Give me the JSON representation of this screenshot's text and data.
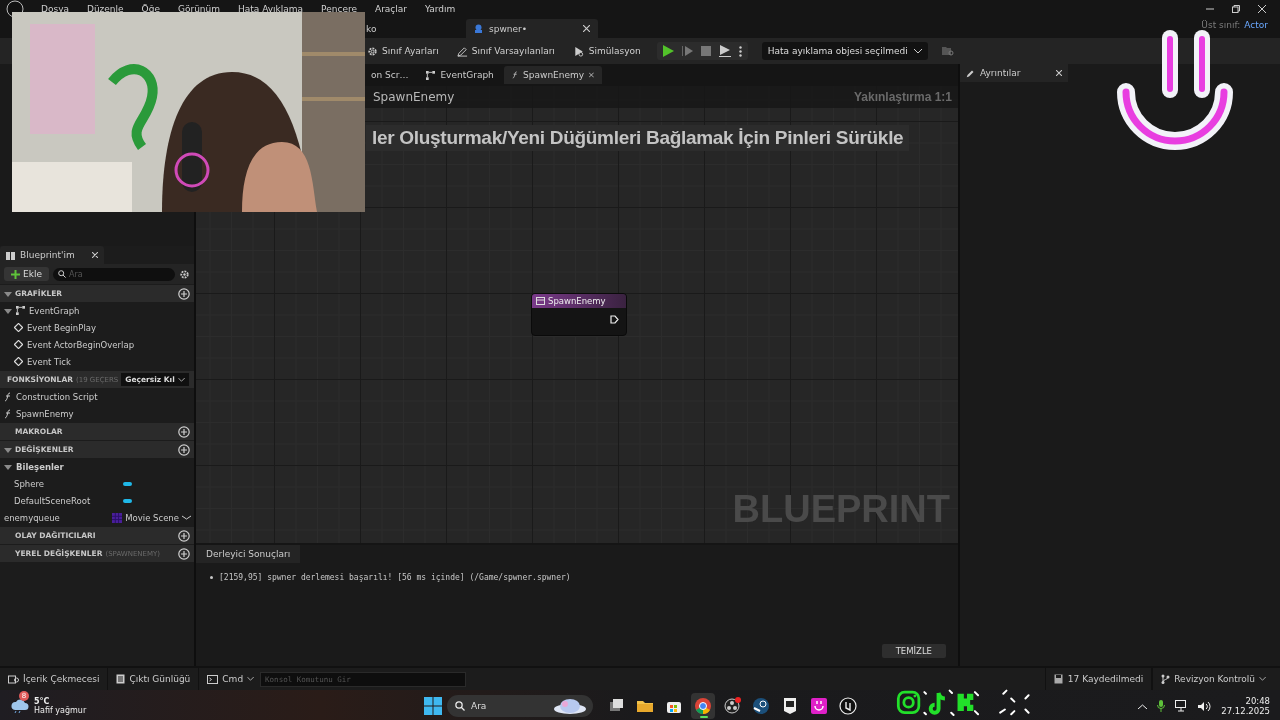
{
  "menu": [
    "Dosya",
    "Düzenle",
    "Öğe",
    "Görünüm",
    "Hata Ayıklama",
    "Pencere",
    "Araçlar",
    "Yardım"
  ],
  "parent_class": {
    "label": "Üst sınıf:",
    "value": "Actor"
  },
  "doc_tabs": [
    {
      "label": "ko",
      "selected": false
    },
    {
      "label": "spwner•",
      "selected": true
    }
  ],
  "toolbar": {
    "buttons": [
      {
        "label": "Sınıf Ayarları",
        "kind": "settings"
      },
      {
        "label": "Sınıf Varsayılanları",
        "kind": "defaults"
      },
      {
        "label": "Simülasyon",
        "kind": "simulate"
      }
    ],
    "debug_dropdown": "Hata ayıklama objesi seçilmedi"
  },
  "graph": {
    "tabs": [
      {
        "label": "on Scr…",
        "selected": false
      },
      {
        "label": "EventGraph",
        "kind": "graph",
        "selected": false
      },
      {
        "label": "SpawnEnemy",
        "kind": "function",
        "selected": true
      }
    ],
    "breadcrumb": "SpawnEnemy",
    "zoom": "Yakınlaştırma 1:1",
    "hint": "ler Oluşturmak/Yeni Düğümleri Bağlamak İçin Pinleri Sürükle",
    "node": {
      "title": "SpawnEnemy"
    },
    "watermark": "BLUEPRINT"
  },
  "my_blueprint": {
    "tab": "Blueprint'im",
    "add": "Ekle",
    "search_placeholder": "Ara",
    "sections": [
      {
        "title": "GRAFİKLER",
        "expanded": true,
        "items": [
          {
            "label": "EventGraph",
            "kind": "graph",
            "children": [
              {
                "label": "Event BeginPlay",
                "kind": "event"
              },
              {
                "label": "Event ActorBeginOverlap",
                "kind": "event"
              },
              {
                "label": "Event Tick",
                "kind": "event"
              }
            ]
          }
        ]
      },
      {
        "title": "FONKSİYONLAR",
        "note": "(19 GEÇERS",
        "dropdown": "Geçersiz Kıl",
        "expanded": true,
        "items": [
          {
            "label": "Construction Script",
            "kind": "function"
          },
          {
            "label": "SpawnEnemy",
            "kind": "function"
          }
        ]
      },
      {
        "title": "MAKROLAR",
        "expanded": false
      },
      {
        "title": "DEĞİŞKENLER",
        "expanded": true,
        "items": [
          {
            "label": "Bileşenler",
            "kind": "category",
            "children": [
              {
                "label": "Sphere",
                "kind": "component"
              },
              {
                "label": "DefaultSceneRoot",
                "kind": "component"
              }
            ]
          },
          {
            "label": "enemyqueue",
            "kind": "variable",
            "type": "Movie Scene"
          }
        ]
      },
      {
        "title": "OLAY DAĞITICILARI",
        "expanded": false
      },
      {
        "title": "YEREL DEĞİŞKENLER",
        "note": "(SPAWNENEMY)",
        "expanded": false
      }
    ]
  },
  "compiler": {
    "tab": "Derleyici Sonuçları",
    "messages": [
      "[2159,95] spwner derlemesi başarılı! [56 ms içinde] (/Game/spwner.spwner)"
    ],
    "clear": "TEMİZLE"
  },
  "details": {
    "tab": "Ayrıntılar"
  },
  "bottom_bar": {
    "drawers": [
      {
        "label": "İçerik Çekmecesi",
        "kind": "content"
      },
      {
        "label": "Çıktı Günlüğü",
        "kind": "log"
      }
    ],
    "cmd": "Cmd",
    "console_placeholder": "Konsol Komutunu Gir",
    "unsaved": "17 Kaydedilmedi",
    "revision": "Revizyon Kontrolü"
  },
  "taskbar": {
    "weather": {
      "badge": "8",
      "temperature": "5°C",
      "description": "Hafif yağmur"
    },
    "search_placeholder": "Ara",
    "apps": [
      {
        "kind": "taskview",
        "selected": false
      },
      {
        "kind": "folder",
        "selected": false
      },
      {
        "kind": "store",
        "selected": false
      },
      {
        "kind": "chrome",
        "selected": true
      },
      {
        "kind": "obs",
        "selected": false
      },
      {
        "kind": "steam",
        "selected": false
      },
      {
        "kind": "epic",
        "selected": false
      },
      {
        "kind": "smile",
        "selected": false
      },
      {
        "kind": "unreal",
        "selected": false
      }
    ],
    "clock": {
      "time": "20:48",
      "date": "27.12.2025"
    }
  }
}
